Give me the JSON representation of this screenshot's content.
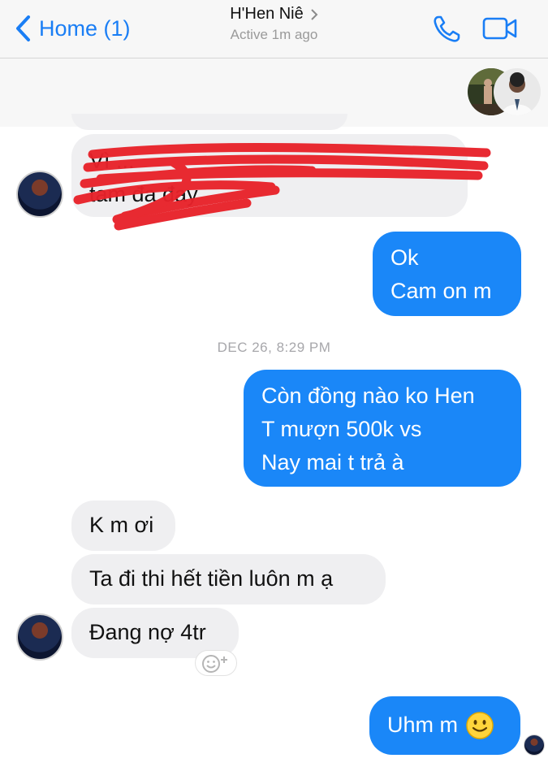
{
  "header": {
    "back_label": "Home (1)",
    "contact_name": "H'Hen Niê",
    "status": "Active 1m ago"
  },
  "messages": {
    "redacted_line1": "Vì ...",
    "redacted_line2": "tam đa đay",
    "out1_line1": "Ok",
    "out1_line2": "Cam on m",
    "timestamp": "DEC 26, 8:29 PM",
    "out2_line1": "Còn đồng nào ko Hen",
    "out2_line2": "T mượn 500k vs",
    "out2_line3": "Nay mai t trả à",
    "in1": "K m ơi",
    "in2": "Ta đi thi hết tiền luôn m ạ",
    "in3": "Đang nợ 4tr",
    "out3": "Uhm m"
  },
  "colors": {
    "accent": "#1a87f8",
    "incoming_bubble": "#efeff1",
    "scribble": "#e8222a"
  },
  "icons": [
    "back-chevron-icon",
    "chevron-right-icon",
    "phone-icon",
    "video-camera-icon",
    "add-reaction-icon",
    "smiley-emoji-icon"
  ]
}
